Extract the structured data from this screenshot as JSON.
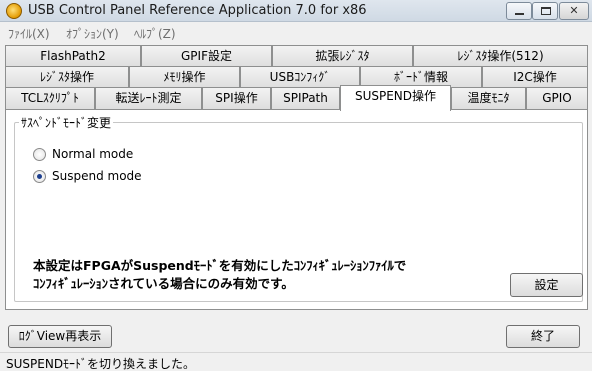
{
  "window": {
    "title": "USB Control Panel Reference Application 7.0 for x86",
    "minimize_label": "",
    "maximize_label": "",
    "close_label": "✕"
  },
  "menu": [
    {
      "label": "ﾌｧｲﾙ(X)"
    },
    {
      "label": "ｵﾌﾟｼｮﾝ(Y)"
    },
    {
      "label": "ﾍﾙﾌﾟ(Z)"
    }
  ],
  "tabs": {
    "row1": [
      "FlashPath2",
      "GPIF設定",
      "拡張ﾚｼﾞｽﾀ",
      "ﾚｼﾞｽﾀ操作(512)"
    ],
    "row2": [
      "ﾚｼﾞｽﾀ操作",
      "ﾒﾓﾘ操作",
      "USBｺﾝﾌｨｸﾞ",
      "ﾎﾞｰﾄﾞ情報",
      "I2C操作"
    ],
    "row3": [
      "TCLｽｸﾘﾌﾟﾄ",
      "転送ﾚｰﾄ測定",
      "SPI操作",
      "SPIPath",
      "SUSPEND操作",
      "温度ﾓﾆﾀ",
      "GPIO"
    ],
    "active": "SUSPEND操作"
  },
  "suspend_panel": {
    "group_title": "ｻｽﾍﾟﾝﾄﾞﾓｰﾄﾞ変更",
    "options": [
      {
        "label": "Normal mode",
        "checked": false
      },
      {
        "label": "Suspend mode",
        "checked": true
      }
    ],
    "note_line1": "本設定はFPGAがSuspendﾓｰﾄﾞを有効にしたｺﾝﾌｨｷﾞｭﾚｰｼｮﾝﾌｧｲﾙで",
    "note_line2": "ｺﾝﾌｨｷﾞｭﾚｰｼｮﾝされている場合にのみ有効です。",
    "set_button": "設定"
  },
  "bottom": {
    "log_button": "ﾛｸﾞView再表示",
    "exit_button": "終了"
  },
  "status": {
    "text": "SUSPENDﾓｰﾄﾞを切り換えました。"
  }
}
